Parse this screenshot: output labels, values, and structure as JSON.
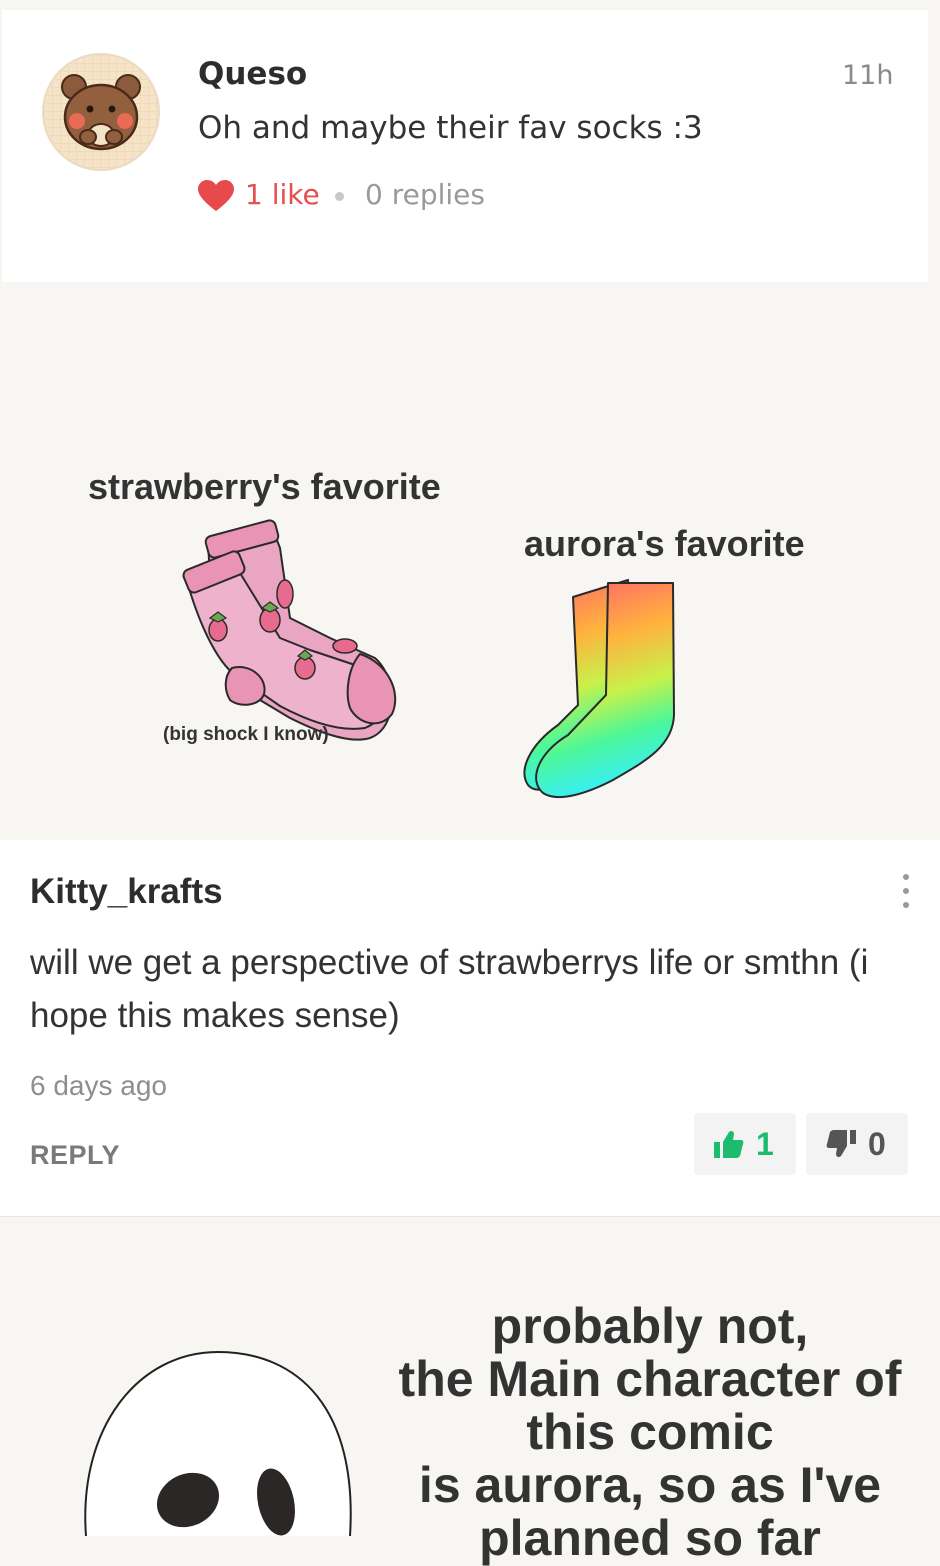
{
  "comment1": {
    "author": "Queso",
    "time": "11h",
    "text": "Oh and maybe their fav socks :3",
    "likes": "1 like",
    "replies": "0 replies"
  },
  "drawing": {
    "label_strawberry": "strawberry's favorite",
    "label_aurora": "aurora's favorite",
    "caption": "(big shock I know)"
  },
  "comment2": {
    "author": "Kitty_krafts",
    "text": "will we get a perspective of strawberrys life or smthn (i hope this makes sense)",
    "time": "6 days ago",
    "reply_label": "REPLY",
    "upvotes": "1",
    "downvotes": "0"
  },
  "reply_panel": {
    "line1": "probably not,",
    "line2": "the Main character of",
    "line3": "this comic",
    "line4": "is aurora, so as I've",
    "line5": "planned so far"
  },
  "colors": {
    "like_red": "#e2514f",
    "upvote_green": "#1cbb6d",
    "sock_pink": "#eaa5c2"
  },
  "icons": [
    "heart-icon",
    "more-options-icon",
    "thumbs-up-icon",
    "thumbs-down-icon"
  ]
}
